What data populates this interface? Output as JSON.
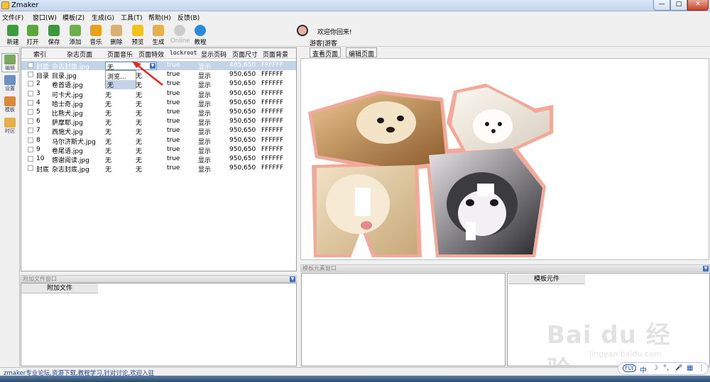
{
  "window": {
    "title": "Zmaker",
    "min": "—",
    "max": "□",
    "close": "✕"
  },
  "menu": [
    {
      "label": "文件(F)"
    },
    {
      "label": "窗口(W)"
    },
    {
      "label": "模板(Z)"
    },
    {
      "label": "生成(G)"
    },
    {
      "label": "工具(T)"
    },
    {
      "label": "帮助(H)"
    },
    {
      "label": "反馈(B)"
    }
  ],
  "toolbar": [
    {
      "label": "新建",
      "icon": "new-icon",
      "color": "#3d9a3d"
    },
    {
      "label": "打开",
      "icon": "open-folder-icon",
      "color": "#5aa83a"
    },
    {
      "label": "保存",
      "icon": "save-icon",
      "color": "#3a9a3a"
    },
    {
      "label": "添加",
      "icon": "add-icon",
      "color": "#6ab04c"
    },
    {
      "label": "音乐",
      "icon": "music-icon",
      "color": "#e6a317"
    },
    {
      "label": "删除",
      "icon": "delete-icon",
      "color": "#d8b070"
    },
    {
      "label": "预览",
      "icon": "star-icon",
      "color": "#f2c21b"
    },
    {
      "label": "生成",
      "icon": "generate-icon",
      "color": "#e8b04a"
    },
    {
      "label": "Online",
      "icon": "online-icon",
      "color": "#cccccc",
      "disabled": true
    },
    {
      "label": "教程",
      "icon": "help-icon",
      "color": "#2c8bd8"
    }
  ],
  "welcome": {
    "greeting": "欢迎你回来!",
    "user": "游客|游客"
  },
  "leftnav": [
    {
      "label": "编辑",
      "icon": "edit-icon",
      "active": true
    },
    {
      "label": "设置",
      "icon": "settings-icon"
    },
    {
      "label": "模板",
      "icon": "template-icon"
    },
    {
      "label": "时区",
      "icon": "timezone-icon"
    }
  ],
  "table": {
    "columns": [
      "索引",
      "杂志页面",
      "页面音乐",
      "页面特效",
      "lockroot",
      "显示页码",
      "页面尺寸",
      "页面背景"
    ],
    "rows": [
      {
        "index": "封面",
        "page": "杂志封面.jpg",
        "music": "无",
        "effect": "无",
        "lockroot": "true",
        "show": "显示",
        "size": "485,650",
        "bg": "FFFFFF",
        "selected": true
      },
      {
        "index": "目录",
        "page": "目录.jpg",
        "music": "无",
        "effect": "无",
        "lockroot": "true",
        "show": "显示",
        "size": "950,650",
        "bg": "FFFFFF"
      },
      {
        "index": "2",
        "page": "卷首语.jpg",
        "music": "无",
        "effect": "无",
        "lockroot": "true",
        "show": "显示",
        "size": "950,650",
        "bg": "FFFFFF"
      },
      {
        "index": "3",
        "page": "可卡犬.jpg",
        "music": "无",
        "effect": "无",
        "lockroot": "true",
        "show": "显示",
        "size": "950,650",
        "bg": "FFFFFF"
      },
      {
        "index": "4",
        "page": "哈士奇.jpg",
        "music": "无",
        "effect": "无",
        "lockroot": "true",
        "show": "显示",
        "size": "950,650",
        "bg": "FFFFFF"
      },
      {
        "index": "5",
        "page": "比熊犬.jpg",
        "music": "无",
        "effect": "无",
        "lockroot": "true",
        "show": "显示",
        "size": "950,650",
        "bg": "FFFFFF"
      },
      {
        "index": "6",
        "page": "萨摩耶.jpg",
        "music": "无",
        "effect": "无",
        "lockroot": "true",
        "show": "显示",
        "size": "950,650",
        "bg": "FFFFFF"
      },
      {
        "index": "7",
        "page": "西施犬.jpg",
        "music": "无",
        "effect": "无",
        "lockroot": "true",
        "show": "显示",
        "size": "950,650",
        "bg": "FFFFFF"
      },
      {
        "index": "8",
        "page": "马尔济斯犬.jpg",
        "music": "无",
        "effect": "无",
        "lockroot": "true",
        "show": "显示",
        "size": "950,650",
        "bg": "FFFFFF"
      },
      {
        "index": "9",
        "page": "卷尾语.jpg",
        "music": "无",
        "effect": "无",
        "lockroot": "true",
        "show": "显示",
        "size": "950,650",
        "bg": "FFFFFF"
      },
      {
        "index": "10",
        "page": "感谢阅读.jpg",
        "music": "无",
        "effect": "无",
        "lockroot": "true",
        "show": "显示",
        "size": "950,650",
        "bg": "FFFFFF"
      },
      {
        "index": "封底",
        "page": "杂志封底.jpg",
        "music": "无",
        "effect": "无",
        "lockroot": "true",
        "show": "显示",
        "size": "950,650",
        "bg": "FFFFFF"
      }
    ],
    "dropdown": {
      "value": "无",
      "options": [
        "浏览...",
        "无"
      ]
    }
  },
  "preview": {
    "view_button": "查看页面",
    "edit_button": "编辑页面"
  },
  "attachments": {
    "header": "附加文件窗口",
    "column": "附加文件"
  },
  "template": {
    "header": "模板元素窗口",
    "column": "模板元件"
  },
  "status": {
    "text": "zmaker专业论坛,资源下载,教程学习,针对讨论,欢迎入驻"
  },
  "ime": {
    "badge": "FLY",
    "lang": "中",
    "moon": "☽",
    "punct": "°,",
    "mic": "🎤",
    "kbd": "▦",
    "menu": "⋮"
  },
  "watermark": {
    "logo": "Bai du 经验",
    "url": "jingyan.baidu.com"
  }
}
